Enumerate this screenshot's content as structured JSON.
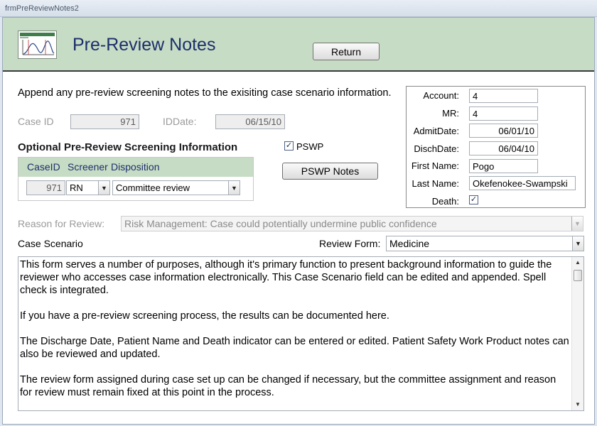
{
  "window": {
    "title": "frmPreReviewNotes2"
  },
  "header": {
    "title": "Pre-Review Notes",
    "return_label": "Return"
  },
  "intro": "Append any pre-review screening notes to the exisiting case scenario information.",
  "case": {
    "case_id_label": "Case ID",
    "case_id": "971",
    "id_date_label": "IDDate:",
    "id_date": "06/15/10"
  },
  "screening": {
    "title": "Optional Pre-Review Screening Information",
    "columns": [
      "CaseID",
      "Screener",
      "Disposition"
    ],
    "row": {
      "case_id": "971",
      "screener": "RN",
      "disposition": "Committee review"
    }
  },
  "pswp": {
    "checkbox_label": "PSWP",
    "checked": true,
    "notes_button": "PSWP Notes"
  },
  "patient": {
    "account_label": "Account:",
    "account": "4",
    "mr_label": "MR:",
    "mr": "4",
    "admit_label": "AdmitDate:",
    "admit": "06/01/10",
    "disch_label": "DischDate:",
    "disch": "06/04/10",
    "first_label": "First Name:",
    "first": "Pogo",
    "last_label": "Last Name:",
    "last": "Okefenokee-Swampski",
    "death_label": "Death:",
    "death": true
  },
  "reason": {
    "label": "Reason for Review:",
    "value": "Risk Management:  Case could potentially undermine public confidence"
  },
  "scenario": {
    "label": "Case Scenario",
    "review_form_label": "Review Form:",
    "review_form": "Medicine",
    "paragraphs": [
      "This form serves a number of purposes, although it's primary function to present background information to guide the reviewer who accesses case information electronically.  This Case Scenario field can be edited and appended.  Spell check is integrated.",
      "If you have a pre-review screening process, the results can be documented here.",
      "The Discharge Date, Patient Name and Death indicator can be entered or edited. Patient Safety Work Product notes can also be reviewed and updated.",
      "The review form assigned during case set up can be changed if necessary, but the committee assignment and reason for review must remain fixed at this point in the process."
    ]
  },
  "icons": {
    "checkmark": "checkmark-icon",
    "dropdown": "chevron-down-icon",
    "scroll_up": "scroll-up-icon",
    "scroll_down": "scroll-down-icon",
    "logo": "chart-logo-icon"
  }
}
